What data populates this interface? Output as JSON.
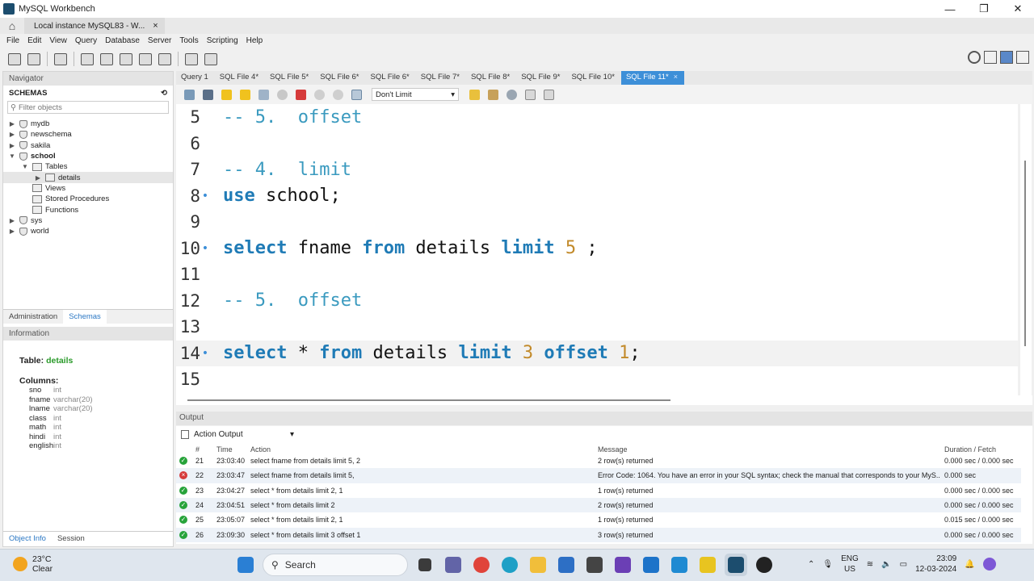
{
  "window": {
    "title": "MySQL Workbench",
    "controls": [
      "—",
      "❐",
      "✕"
    ]
  },
  "doc_tab": {
    "label": "Local instance MySQL83 - W...",
    "close": "×"
  },
  "menu": [
    "File",
    "Edit",
    "View",
    "Query",
    "Database",
    "Server",
    "Tools",
    "Scripting",
    "Help"
  ],
  "navigator": {
    "title": "Navigator",
    "schemas_title": "SCHEMAS",
    "filter_placeholder": "Filter objects",
    "tree": [
      {
        "label": "mydb",
        "level": 0,
        "arrow": "▶"
      },
      {
        "label": "newschema",
        "level": 0,
        "arrow": "▶"
      },
      {
        "label": "sakila",
        "level": 0,
        "arrow": "▶"
      },
      {
        "label": "school",
        "level": 0,
        "arrow": "▼",
        "bold": true
      },
      {
        "label": "Tables",
        "level": 1,
        "arrow": "▼"
      },
      {
        "label": "details",
        "level": 2,
        "arrow": "▶",
        "selected": true
      },
      {
        "label": "Views",
        "level": 1,
        "arrow": ""
      },
      {
        "label": "Stored Procedures",
        "level": 1,
        "arrow": ""
      },
      {
        "label": "Functions",
        "level": 1,
        "arrow": ""
      },
      {
        "label": "sys",
        "level": 0,
        "arrow": "▶"
      },
      {
        "label": "world",
        "level": 0,
        "arrow": "▶"
      }
    ],
    "tabs": [
      "Administration",
      "Schemas"
    ],
    "active_tab": "Schemas"
  },
  "information": {
    "title": "Information",
    "table_label": "Table:",
    "table_name": "details",
    "columns_label": "Columns:",
    "columns": [
      {
        "name": "sno",
        "type": "int"
      },
      {
        "name": "fname",
        "type": "varchar(20)"
      },
      {
        "name": "lname",
        "type": "varchar(20)"
      },
      {
        "name": "class",
        "type": "int"
      },
      {
        "name": "math",
        "type": "int"
      },
      {
        "name": "hindi",
        "type": "int"
      },
      {
        "name": "english",
        "type": "int"
      }
    ],
    "bottom_tabs": [
      "Object Info",
      "Session"
    ]
  },
  "sql_tabs": [
    {
      "label": "Query 1",
      "closable": false
    },
    {
      "label": "SQL File 4*",
      "closable": false
    },
    {
      "label": "SQL File 5*",
      "closable": false
    },
    {
      "label": "SQL File 6*",
      "closable": false
    },
    {
      "label": "SQL File 6*",
      "closable": false
    },
    {
      "label": "SQL File 7*",
      "closable": false
    },
    {
      "label": "SQL File 8*",
      "closable": false
    },
    {
      "label": "SQL File 9*",
      "closable": false
    },
    {
      "label": "SQL File 10*",
      "closable": false
    },
    {
      "label": "SQL File 11*",
      "closable": true,
      "active": true
    }
  ],
  "editor_toolbar": {
    "limit_label": "Don't Limit"
  },
  "editor": {
    "lines": [
      {
        "n": "5",
        "dot": false,
        "tokens": [
          {
            "t": "-- 5.  offset",
            "c": "cm"
          }
        ]
      },
      {
        "n": "6",
        "dot": false,
        "tokens": []
      },
      {
        "n": "7",
        "dot": false,
        "tokens": [
          {
            "t": "-- 4.  limit",
            "c": "cm"
          }
        ]
      },
      {
        "n": "8",
        "dot": true,
        "tokens": [
          {
            "t": "use",
            "c": "kw"
          },
          {
            "t": " school;",
            "c": ""
          }
        ]
      },
      {
        "n": "9",
        "dot": false,
        "tokens": []
      },
      {
        "n": "10",
        "dot": true,
        "tokens": [
          {
            "t": "select",
            "c": "kw"
          },
          {
            "t": " fname ",
            "c": ""
          },
          {
            "t": "from",
            "c": "kw"
          },
          {
            "t": " details ",
            "c": ""
          },
          {
            "t": "limit",
            "c": "kw"
          },
          {
            "t": " ",
            "c": ""
          },
          {
            "t": "5",
            "c": "num"
          },
          {
            "t": " ;",
            "c": ""
          }
        ]
      },
      {
        "n": "11",
        "dot": false,
        "tokens": []
      },
      {
        "n": "12",
        "dot": false,
        "tokens": [
          {
            "t": "-- 5.  offset",
            "c": "cm"
          }
        ]
      },
      {
        "n": "13",
        "dot": false,
        "tokens": []
      },
      {
        "n": "14",
        "dot": true,
        "current": true,
        "tokens": [
          {
            "t": "select",
            "c": "kw"
          },
          {
            "t": " * ",
            "c": ""
          },
          {
            "t": "from",
            "c": "kw"
          },
          {
            "t": " details ",
            "c": ""
          },
          {
            "t": "limit",
            "c": "kw"
          },
          {
            "t": " ",
            "c": ""
          },
          {
            "t": "3",
            "c": "num"
          },
          {
            "t": " ",
            "c": ""
          },
          {
            "t": "offset",
            "c": "kw"
          },
          {
            "t": " ",
            "c": ""
          },
          {
            "t": "1",
            "c": "num"
          },
          {
            "t": ";",
            "c": ""
          }
        ]
      },
      {
        "n": "15",
        "dot": false,
        "tokens": []
      }
    ]
  },
  "output": {
    "title": "Output",
    "mode": "Action Output",
    "headers": {
      "num": "#",
      "time": "Time",
      "action": "Action",
      "message": "Message",
      "duration": "Duration / Fetch"
    },
    "rows": [
      {
        "status": "ok",
        "num": "21",
        "time": "23:03:40",
        "action": "select fname from details limit 5, 2",
        "message": "2 row(s) returned",
        "duration": "0.000 sec / 0.000 sec"
      },
      {
        "status": "err",
        "num": "22",
        "time": "23:03:47",
        "action": "select fname from details limit 5,",
        "message": "Error Code: 1064. You have an error in your SQL syntax; check the manual that corresponds to your MyS...",
        "duration": "0.000 sec"
      },
      {
        "status": "ok",
        "num": "23",
        "time": "23:04:27",
        "action": "select * from details limit 2, 1",
        "message": "1 row(s) returned",
        "duration": "0.000 sec / 0.000 sec"
      },
      {
        "status": "ok",
        "num": "24",
        "time": "23:04:51",
        "action": "select * from details limit 2",
        "message": "2 row(s) returned",
        "duration": "0.000 sec / 0.000 sec"
      },
      {
        "status": "ok",
        "num": "25",
        "time": "23:05:07",
        "action": "select * from details limit 2, 1",
        "message": "1 row(s) returned",
        "duration": "0.015 sec / 0.000 sec"
      },
      {
        "status": "ok",
        "num": "26",
        "time": "23:09:30",
        "action": "select * from details limit 3 offset 1",
        "message": "3 row(s) returned",
        "duration": "0.000 sec / 0.000 sec"
      }
    ]
  },
  "taskbar": {
    "temp": "23°C",
    "weather": "Clear",
    "search": "Search",
    "lang_top": "ENG",
    "lang_bottom": "US",
    "time": "23:09",
    "date": "12-03-2024"
  },
  "colors": {
    "accent": "#3d8fd8",
    "keyword": "#1f7bb6",
    "comment": "#3a9abf",
    "number": "#c28a2a",
    "ok": "#27a33a",
    "error": "#d63b3b"
  }
}
